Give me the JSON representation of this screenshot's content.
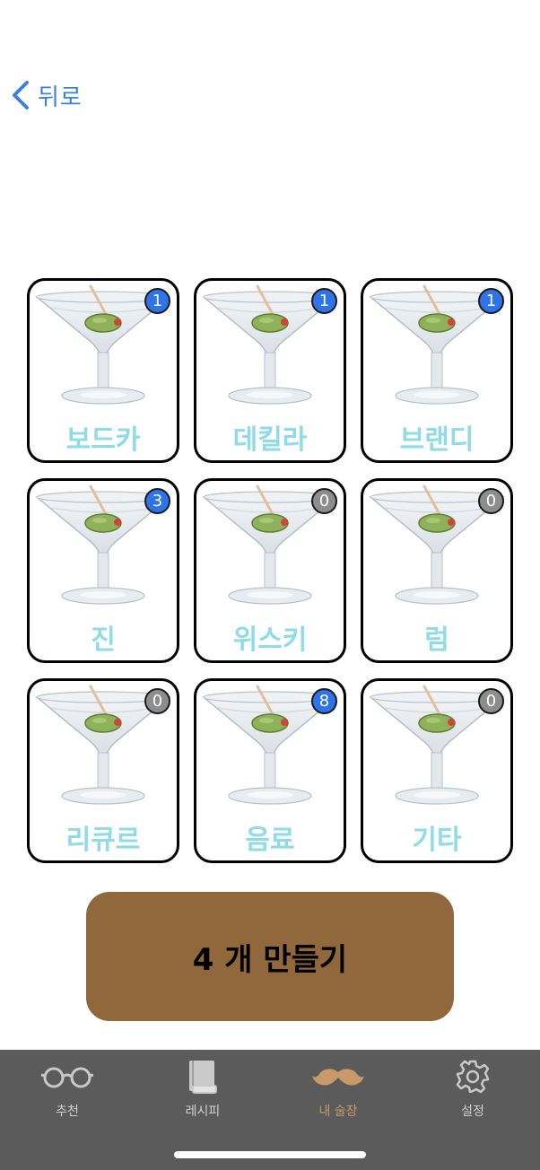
{
  "nav": {
    "back_label": "뒤로"
  },
  "categories": [
    {
      "label": "보드카",
      "count": "1"
    },
    {
      "label": "데킬라",
      "count": "1"
    },
    {
      "label": "브랜디",
      "count": "1"
    },
    {
      "label": "진",
      "count": "3"
    },
    {
      "label": "위스키",
      "count": "0"
    },
    {
      "label": "럼",
      "count": "0"
    },
    {
      "label": "리큐르",
      "count": "0"
    },
    {
      "label": "음료",
      "count": "8"
    },
    {
      "label": "기타",
      "count": "0"
    }
  ],
  "make_button": {
    "label": "4 개 만들기"
  },
  "tabs": [
    {
      "label": "추천",
      "icon": "glasses-icon"
    },
    {
      "label": "레시피",
      "icon": "book-icon"
    },
    {
      "label": "내 술장",
      "icon": "mustache-icon",
      "active": true
    },
    {
      "label": "설정",
      "icon": "gear-icon"
    }
  ],
  "colors": {
    "accent_blue": "#2f73e8",
    "badge_zero": "#8d8d8d",
    "label_cyan": "#8fdbe8",
    "button_brown": "#91683c",
    "tab_active": "#c79a67",
    "tabbar_bg": "#5b5b5b"
  }
}
